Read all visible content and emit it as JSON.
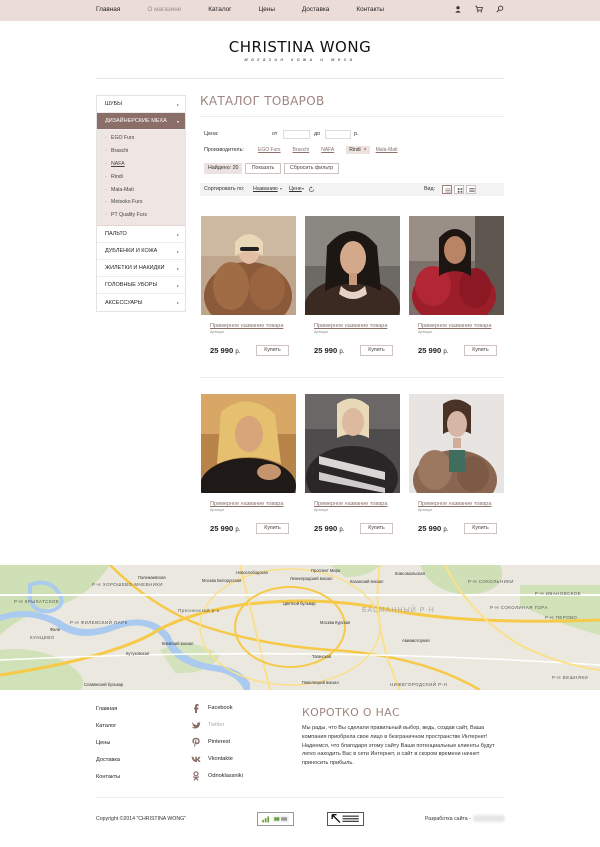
{
  "topnav": {
    "items": [
      {
        "label": "Главная"
      },
      {
        "label": "О магазине"
      },
      {
        "label": "Каталог"
      },
      {
        "label": "Цены"
      },
      {
        "label": "Доставка"
      },
      {
        "label": "Контакты"
      }
    ],
    "icons": [
      "user-icon",
      "cart-icon",
      "search-icon"
    ]
  },
  "logo": {
    "brand": "CHRISTINA WONG",
    "tagline": "магазин кожи и меха"
  },
  "sidebar": {
    "items": [
      {
        "label": "ШУБЫ"
      },
      {
        "label": "ДИЗАЙНЕРСКИЕ МЕХА"
      },
      {
        "label": "ПАЛЬТО"
      },
      {
        "label": "ДУБЛЕНКИ И КОЖА"
      },
      {
        "label": "ЖИЛЕТКИ И НАКИДКИ"
      },
      {
        "label": "ГОЛОВНЫЕ УБОРЫ"
      },
      {
        "label": "АКСЕССУАРЫ"
      }
    ],
    "subitems": [
      {
        "label": "EGO Furs"
      },
      {
        "label": "Braschi"
      },
      {
        "label": "NAFA"
      },
      {
        "label": "Rindi"
      },
      {
        "label": "Mala-Mati"
      },
      {
        "label": "Metsoko Furs"
      },
      {
        "label": "PT Quality Furs"
      }
    ]
  },
  "catalog": {
    "title": "КАТАЛОГ ТОВАРОВ",
    "filter": {
      "price_label": "Цена:",
      "from_label": "от",
      "to_label": "до",
      "currency": "р.",
      "from_value": "",
      "to_value": "",
      "maker_label": "Производитель:",
      "makers": [
        {
          "label": "EGO Furs"
        },
        {
          "label": "Braschi"
        },
        {
          "label": "NAFA"
        },
        {
          "label": "Rindi",
          "selected": true
        },
        {
          "label": "Mala-Mati"
        }
      ],
      "found_text": "Найдено: 20",
      "show_button": "Показать",
      "reset_button": "Сбросить фильтр"
    },
    "sort": {
      "label": "Сортировать по:",
      "options": [
        {
          "label": "Названию"
        },
        {
          "label": "Цене"
        }
      ],
      "view_label": "Вид:"
    },
    "products": [
      {
        "name": "Примерное название товара",
        "article": "Артикул",
        "price": "25 990",
        "currency": "р.",
        "buy": "Купить"
      },
      {
        "name": "Примерное название товара",
        "article": "Артикул",
        "price": "25 990",
        "currency": "р.",
        "buy": "Купить"
      },
      {
        "name": "Примерное название товара",
        "article": "Артикул",
        "price": "25 990",
        "currency": "р.",
        "buy": "Купить"
      },
      {
        "name": "Примерное название товара",
        "article": "Артикул",
        "price": "25 990",
        "currency": "р.",
        "buy": "Купить"
      },
      {
        "name": "Примерное название товара",
        "article": "Артикул",
        "price": "25 990",
        "currency": "р.",
        "buy": "Купить"
      },
      {
        "name": "Примерное название товара",
        "article": "Артикул",
        "price": "25 990",
        "currency": "р.",
        "buy": "Купить"
      }
    ]
  },
  "map": {
    "labels": [
      {
        "text": "Полежаевская"
      },
      {
        "text": "Р-Н ХОРОШЕВО-МНЕВНИКИ"
      },
      {
        "text": "Новослободская"
      },
      {
        "text": "Проспект Мира"
      },
      {
        "text": "Комсомольская"
      },
      {
        "text": "Р-Н СОКОЛЬНИКИ"
      },
      {
        "text": "Р-Н КРЫЛАТСКОЕ"
      },
      {
        "text": "Москва Белорусская"
      },
      {
        "text": "Ленинградский вокзал"
      },
      {
        "text": "Казанский вокзал"
      },
      {
        "text": "Р-Н ФИЛЕВСКИЙ ПАРК"
      },
      {
        "text": "Пресненский р-н"
      },
      {
        "text": "Цветной бульвар"
      },
      {
        "text": "БАСМАННЫЙ Р-Н"
      },
      {
        "text": "Р-Н СОКОЛИНАЯ ГОРА"
      },
      {
        "text": "Р-Н ПЕРОВО"
      },
      {
        "text": "КУНЦЕВО"
      },
      {
        "text": "Москва Курская"
      },
      {
        "text": "Авиамоторная"
      },
      {
        "text": "Киевский вокзал"
      },
      {
        "text": "Кутузовская"
      },
      {
        "text": "Таганская"
      },
      {
        "text": "Р-Н ВЕШНЯКИ"
      },
      {
        "text": "Павелецкий вокзал"
      },
      {
        "text": "НИЖЕГОРОДСКИЙ Р-Н"
      },
      {
        "text": "Славянский бульвар"
      },
      {
        "text": "Фили"
      },
      {
        "text": "Р-Н ИВАНОВСКОЕ"
      }
    ]
  },
  "footer": {
    "nav": [
      {
        "label": "Главная"
      },
      {
        "label": "Каталог"
      },
      {
        "label": "Цены"
      },
      {
        "label": "Доставка"
      },
      {
        "label": "Контакты"
      }
    ],
    "social": [
      {
        "label": "Facebook",
        "icon": "facebook-icon"
      },
      {
        "label": "Twitter",
        "icon": "twitter-icon"
      },
      {
        "label": "Pinterest",
        "icon": "pinterest-icon"
      },
      {
        "label": "Vkontakte",
        "icon": "vkontakte-icon"
      },
      {
        "label": "Odnoklassniki",
        "icon": "odnoklassniki-icon"
      }
    ],
    "about_title": "КОРОТКО О НАС",
    "about_p1": "Мы рады, что Вы сделали правильный выбор, ведь, создав сайт, Ваша компания приобрела свое лицо в безграничном пространстве Интернет!",
    "about_p2": "Надеемся, что благодаря этому сайту Ваши потенциальные клиенты будут легко находить Вас в сети Интернет, и сайт в скором времени начнет приносить прибыль.",
    "copyright": "Copyright ©2014 \"CHRISTINA WONG\"",
    "developer_label": "Разработка сайта -",
    "colors": {
      "accent": "#9e8580",
      "active": "#8c6e69",
      "topbar": "#ecdcd8"
    }
  }
}
